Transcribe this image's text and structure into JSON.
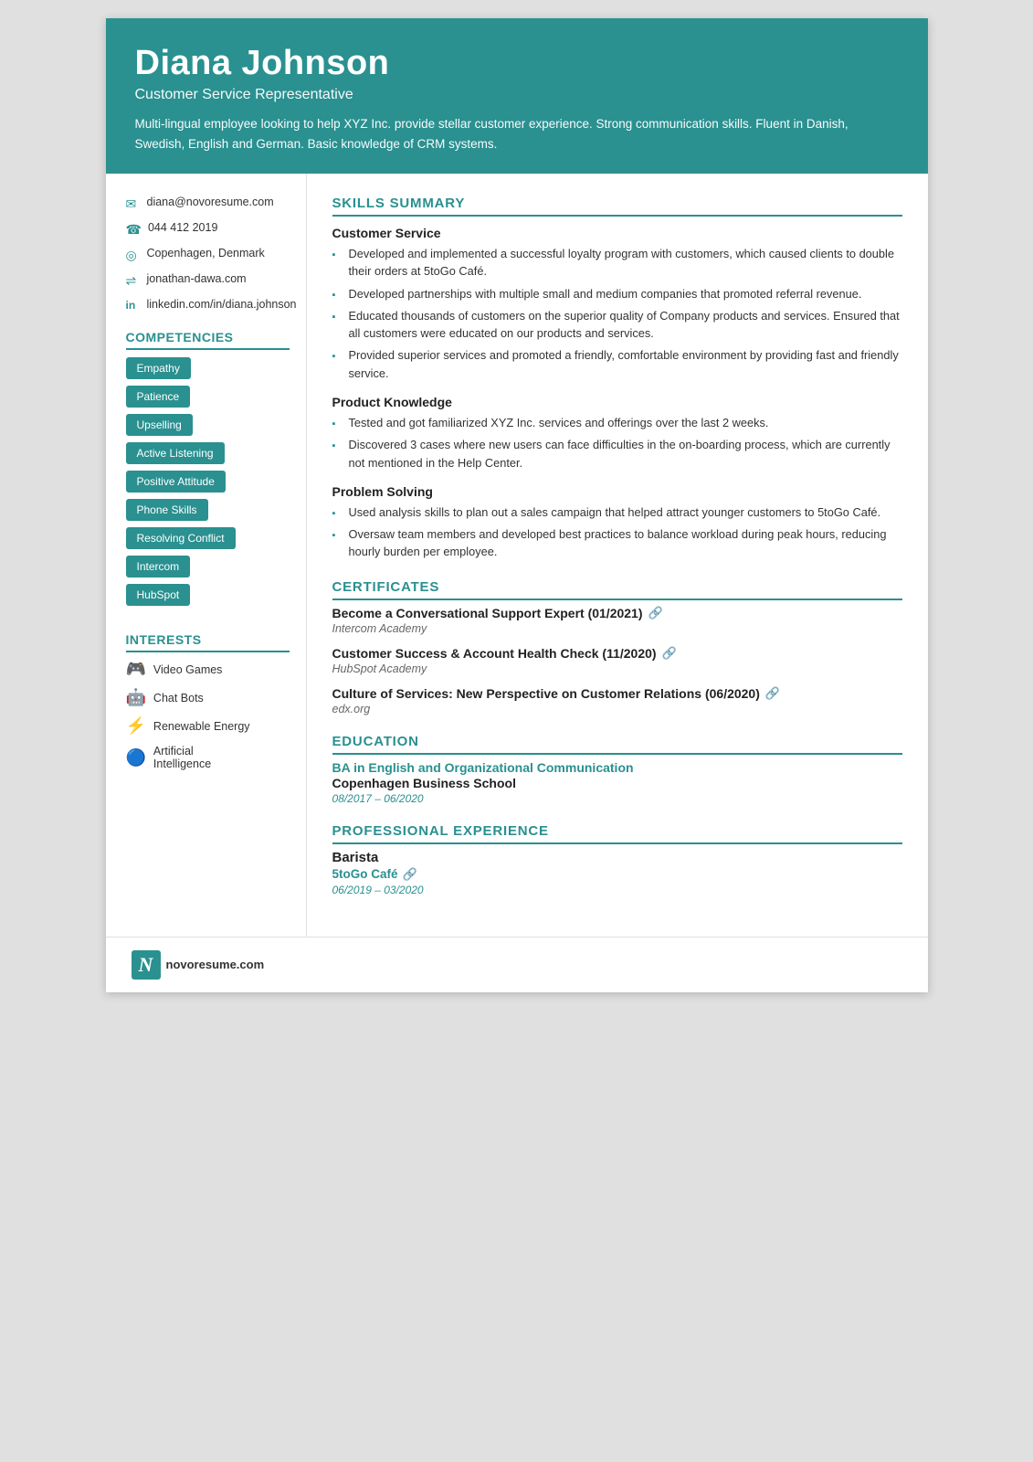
{
  "header": {
    "name": "Diana Johnson",
    "title": "Customer Service Representative",
    "summary": "Multi-lingual employee looking to help XYZ Inc. provide stellar customer experience. Strong communication skills. Fluent in Danish, Swedish, English and German. Basic knowledge of CRM systems."
  },
  "contact": [
    {
      "icon": "✉",
      "text": "diana@novoresume.com",
      "type": "email"
    },
    {
      "icon": "☎",
      "text": "044 412 2019",
      "type": "phone"
    },
    {
      "icon": "◎",
      "text": "Copenhagen, Denmark",
      "type": "location"
    },
    {
      "icon": "⇌",
      "text": "jonathan-dawa.com",
      "type": "website"
    },
    {
      "icon": "in",
      "text": "linkedin.com/in/diana.johnson",
      "type": "linkedin"
    }
  ],
  "competencies": {
    "title": "COMPETENCIES",
    "items": [
      "Empathy",
      "Patience",
      "Upselling",
      "Active Listening",
      "Positive Attitude",
      "Phone Skills",
      "Resolving Conflict",
      "Intercom",
      "HubSpot"
    ]
  },
  "interests": {
    "title": "INTERESTS",
    "items": [
      {
        "icon": "🎮",
        "label": "Video Games"
      },
      {
        "icon": "🤖",
        "label": "Chat Bots"
      },
      {
        "icon": "⚡",
        "label": "Renewable Energy"
      },
      {
        "icon": "🔵",
        "label": "Artificial Intelligence"
      }
    ]
  },
  "skills_summary": {
    "title": "SKILLS SUMMARY",
    "subsections": [
      {
        "title": "Customer Service",
        "bullets": [
          "Developed and implemented a successful loyalty program with customers, which caused clients to double their orders at 5toGo Café.",
          "Developed partnerships with multiple small and medium companies that promoted referral revenue.",
          "Educated thousands of customers on the superior quality of Company products and services. Ensured that all customers were educated on our products and services.",
          "Provided superior services and promoted a friendly, comfortable environment by providing fast and friendly service."
        ]
      },
      {
        "title": "Product Knowledge",
        "bullets": [
          "Tested and got familiarized XYZ Inc. services and offerings over the last 2 weeks.",
          "Discovered 3 cases where new users can face difficulties in the on-boarding process, which are currently not mentioned in the Help Center."
        ]
      },
      {
        "title": "Problem Solving",
        "bullets": [
          "Used analysis skills to plan out a sales campaign that helped attract younger customers to 5toGo Café.",
          "Oversaw team members and developed best practices to balance workload during peak hours, reducing hourly burden per employee."
        ]
      }
    ]
  },
  "certificates": {
    "title": "CERTIFICATES",
    "items": [
      {
        "title": "Become a Conversational Support Expert (01/2021)",
        "org": "Intercom Academy"
      },
      {
        "title": "Customer Success & Account Health Check (11/2020)",
        "org": "HubSpot Academy"
      },
      {
        "title": "Culture of Services: New Perspective on Customer Relations (06/2020)",
        "org": "edx.org"
      }
    ]
  },
  "education": {
    "title": "EDUCATION",
    "degree": "BA in English and Organizational Communication",
    "school": "Copenhagen Business School",
    "date": "08/2017 – 06/2020"
  },
  "experience": {
    "title": "PROFESSIONAL EXPERIENCE",
    "jobs": [
      {
        "job_title": "Barista",
        "company": "5toGo Café",
        "date": "06/2019 – 03/2020"
      }
    ]
  },
  "footer": {
    "logo_letter": "N",
    "url": "novoresume.com"
  }
}
